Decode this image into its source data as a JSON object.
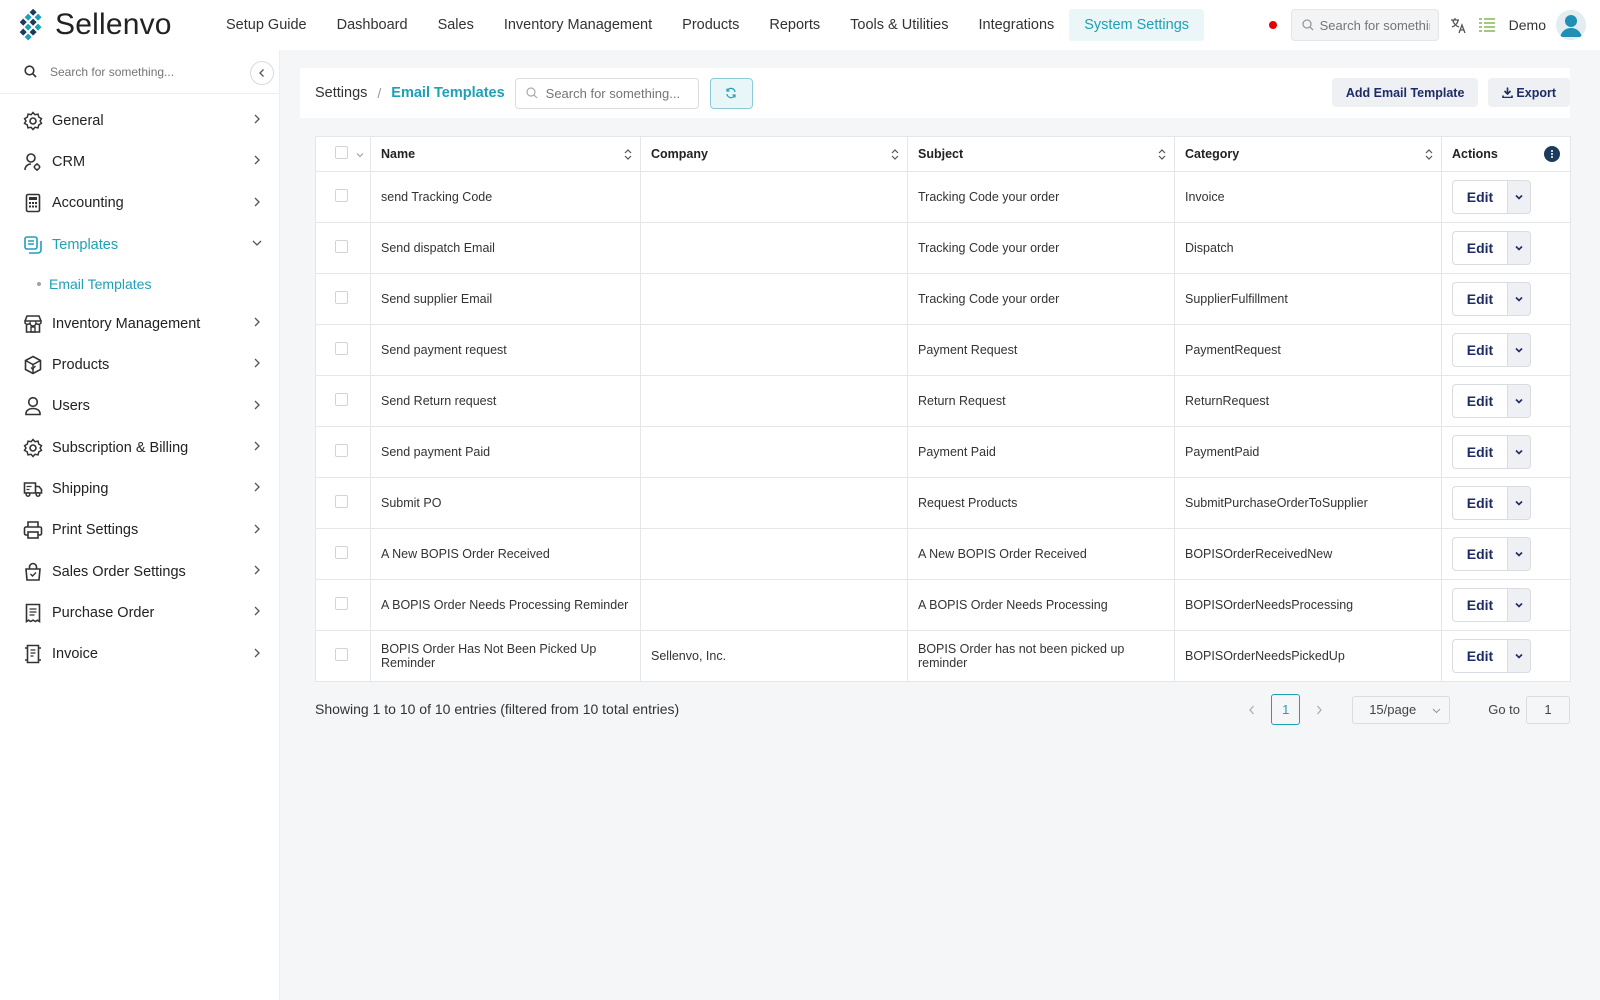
{
  "app": {
    "brand": "Sellenvo"
  },
  "topnav": {
    "items": [
      "Setup Guide",
      "Dashboard",
      "Sales",
      "Inventory Management",
      "Products",
      "Reports",
      "Tools & Utilities",
      "Integrations",
      "System Settings"
    ],
    "active": "System Settings",
    "search_placeholder": "Search for something...",
    "user": "Demo"
  },
  "sidebar": {
    "search_placeholder": "Search for something...",
    "items": [
      {
        "label": "General",
        "icon": "gear-icon"
      },
      {
        "label": "CRM",
        "icon": "crm-icon"
      },
      {
        "label": "Accounting",
        "icon": "calculator-icon"
      },
      {
        "label": "Templates",
        "icon": "templates-icon",
        "open": true,
        "children": [
          "Email Templates"
        ]
      },
      {
        "label": "Inventory Management",
        "icon": "store-icon"
      },
      {
        "label": "Products",
        "icon": "box-icon"
      },
      {
        "label": "Users",
        "icon": "user-icon"
      },
      {
        "label": "Subscription & Billing",
        "icon": "gear-icon"
      },
      {
        "label": "Shipping",
        "icon": "truck-icon"
      },
      {
        "label": "Print Settings",
        "icon": "printer-icon"
      },
      {
        "label": "Sales Order Settings",
        "icon": "bag-icon"
      },
      {
        "label": "Purchase Order",
        "icon": "receipt-icon"
      },
      {
        "label": "Invoice",
        "icon": "invoice-icon"
      }
    ]
  },
  "breadcrumb": {
    "parent": "Settings",
    "separator": "/",
    "current": "Email Templates"
  },
  "toolbar": {
    "search_placeholder": "Search for something...",
    "add_label": "Add Email Template",
    "export_label": "Export"
  },
  "table": {
    "headers": {
      "name": "Name",
      "company": "Company",
      "subject": "Subject",
      "category": "Category",
      "actions": "Actions"
    },
    "edit_label": "Edit",
    "rows": [
      {
        "name": "send Tracking Code",
        "company": "",
        "subject": "Tracking Code your order",
        "category": "Invoice"
      },
      {
        "name": "Send dispatch Email",
        "company": "",
        "subject": "Tracking Code your order",
        "category": "Dispatch"
      },
      {
        "name": "Send supplier Email",
        "company": "",
        "subject": "Tracking Code your order",
        "category": "SupplierFulfillment"
      },
      {
        "name": "Send payment request",
        "company": "",
        "subject": "Payment Request",
        "category": "PaymentRequest"
      },
      {
        "name": "Send Return request",
        "company": "",
        "subject": "Return Request",
        "category": "ReturnRequest"
      },
      {
        "name": "Send payment Paid",
        "company": "",
        "subject": "Payment Paid",
        "category": "PaymentPaid"
      },
      {
        "name": "Submit PO",
        "company": "",
        "subject": "Request Products",
        "category": "SubmitPurchaseOrderToSupplier"
      },
      {
        "name": "A New BOPIS Order Received",
        "company": "",
        "subject": "A New BOPIS Order Received",
        "category": "BOPISOrderReceivedNew"
      },
      {
        "name": "A BOPIS Order Needs Processing Reminder",
        "company": "",
        "subject": "A BOPIS Order Needs Processing",
        "category": "BOPISOrderNeedsProcessing"
      },
      {
        "name": "BOPIS Order Has Not Been Picked Up Reminder",
        "company": "Sellenvo, Inc.",
        "subject": "BOPIS Order has not been picked up reminder",
        "category": "BOPISOrderNeedsPickedUp"
      }
    ]
  },
  "footer": {
    "entries_text": "Showing 1 to 10 of 10 entries (filtered from 10 total entries)",
    "current_page": "1",
    "per_page": "15/page",
    "goto_label": "Go to",
    "goto_value": "1"
  },
  "colors": {
    "accent": "#1ea0b5",
    "navy": "#1d2c66",
    "alert": "#e80000"
  }
}
